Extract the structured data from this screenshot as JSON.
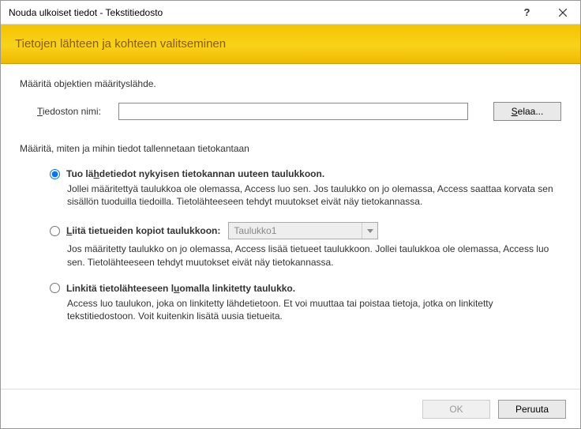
{
  "window": {
    "title": "Nouda ulkoiset tiedot - Tekstitiedosto",
    "help": "?",
    "close_aria": "Close"
  },
  "banner": {
    "title": "Tietojen lähteen ja kohteen valitseminen"
  },
  "source": {
    "section_label": "Määritä objektien määrityslähde.",
    "file_label": "Tiedoston nimi:",
    "file_value": "",
    "browse": "Selaa..."
  },
  "dest": {
    "section_label": "Määritä, miten ja mihin tiedot tallennetaan tietokantaan",
    "options": [
      {
        "id": "opt_import",
        "label_pre": "Tuo lä",
        "label_ul": "h",
        "label_post": "detiedot nykyisen tietokannan uuteen taulukkoon.",
        "desc": "Jollei määritettyä taulukkoa ole olemassa, Access luo sen. Jos taulukko on jo olemassa, Access saattaa korvata sen sisällön tuoduilla tiedoilla. Tietolähteeseen tehdyt muutokset eivät näy tietokannassa.",
        "checked": true
      },
      {
        "id": "opt_append",
        "label_pre": "",
        "label_ul": "L",
        "label_post": "iitä tietueiden kopiot taulukkoon:",
        "combo_value": "Taulukko1",
        "desc": "Jos määritetty taulukko on jo olemassa, Access lisää tietueet taulukkoon. Jollei taulukkoa ole olemassa, Access luo sen. Tietolähteeseen tehdyt muutokset eivät näy tietokannassa.",
        "checked": false
      },
      {
        "id": "opt_link",
        "label_pre": "Linkitä tietolähteeseen l",
        "label_ul": "u",
        "label_post": "omalla linkitetty taulukko.",
        "desc": "Access luo taulukon, joka on linkitetty lähdetietoon. Et voi muuttaa tai poistaa tietoja, jotka on linkitetty tekstitiedostoon. Voit kuitenkin lisätä uusia tietueita.",
        "checked": false
      }
    ]
  },
  "footer": {
    "ok": "OK",
    "cancel": "Peruuta"
  }
}
